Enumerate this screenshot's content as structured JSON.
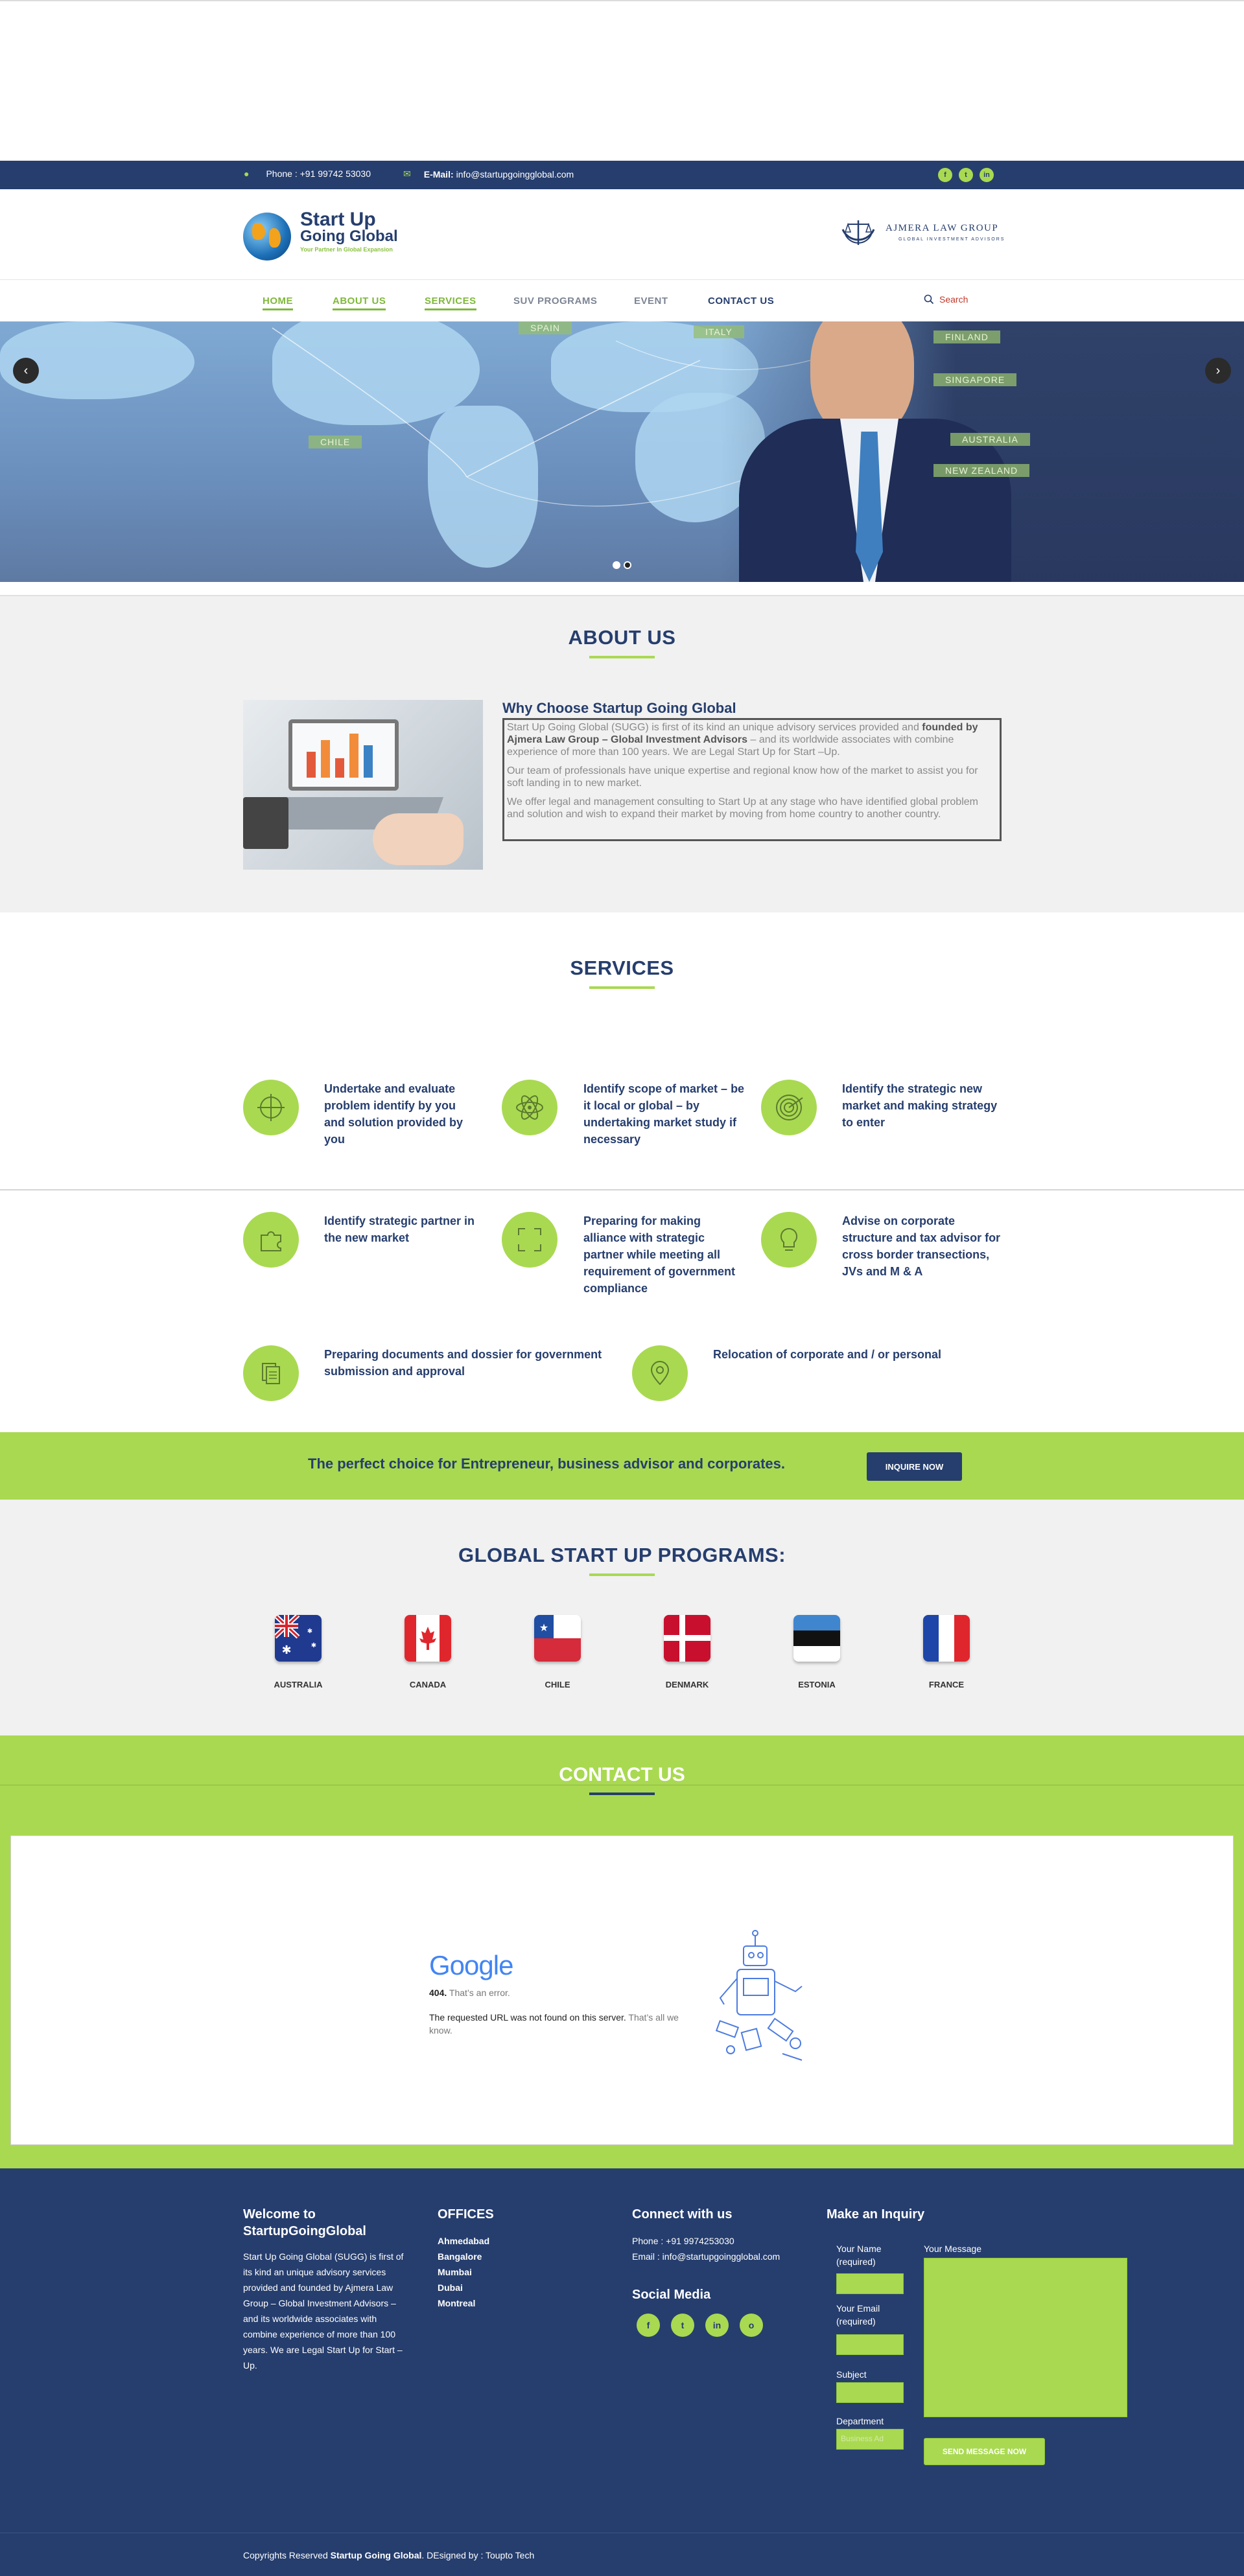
{
  "topbar": {
    "phone": "Phone : +91 99742 53030",
    "email_label": "E-Mail:",
    "email": "info@startupgoingglobal.com",
    "social": [
      "f",
      "t",
      "in"
    ]
  },
  "header": {
    "logo_line1": "Start Up",
    "logo_line2": "Going Global",
    "logo_tagline": "Your Partner In Global Expansion",
    "partner_name": "AJMERA LAW GROUP",
    "partner_tagline": "GLOBAL INVESTMENT ADVISORS"
  },
  "nav": {
    "items": [
      "HOME",
      "ABOUT US",
      "SERVICES",
      "SUV PROGRAMS",
      "EVENT",
      "CONTACT US"
    ],
    "search": "Search"
  },
  "hero": {
    "tags": [
      "SPAIN",
      "ITALY",
      "FINLAND",
      "SINGAPORE",
      "CHILE",
      "AUSTRALIA",
      "NEW ZEALAND"
    ]
  },
  "about": {
    "title": "ABOUT US",
    "heading": "Why Choose Startup Going Global",
    "p1_a": "Start Up Going Global (SUGG) is first of its kind an unique advisory services provided and ",
    "p1_b": "founded by Ajmera Law Group – Global Investment Advisors",
    "p1_c": " – and its worldwide associates with combine experience of more than 100 years. We are Legal Start Up for Start –Up.",
    "p2": "Our team of professionals have unique expertise and regional know how of the market to assist you for soft landing in to new market.",
    "p3": "We offer legal and management consulting to Start Up at any stage who have identified global problem and solution and wish to expand their market by moving from home country to another country."
  },
  "services": {
    "title": "SERVICES",
    "items": [
      "Undertake and evaluate problem identify by you and solution provided by you",
      "Identify scope of market – be it local or global – by undertaking market study if necessary",
      "Identify the strategic new market and making strategy to enter",
      "Identify strategic partner in the new market",
      "Preparing for making alliance with strategic partner while meeting all requirement of government compliance",
      "Advise on corporate structure and tax advisor for cross border transections, JVs and M & A",
      "Preparing documents and dossier for government submission and approval",
      "Relocation of corporate and / or personal"
    ]
  },
  "band": {
    "text": "The perfect choice for Entrepreneur, business advisor and corporates.",
    "button": "INQUIRE NOW"
  },
  "programs": {
    "title": "GLOBAL START UP PROGRAMS:",
    "countries": [
      "AUSTRALIA",
      "CANADA",
      "CHILE",
      "DENMARK",
      "ESTONIA",
      "FRANCE"
    ]
  },
  "contact": {
    "title": "CONTACT US",
    "map_brand": "Google",
    "map_code": "404.",
    "map_error": "That’s an error.",
    "map_msg_a": "The requested URL was not found on this server.",
    "map_msg_b": "That’s all we know."
  },
  "footer": {
    "welcome_title": "Welcome to StartupGoingGlobal",
    "welcome_text": "Start Up Going Global (SUGG) is first of its kind an unique advisory services provided and founded by Ajmera Law Group – Global Investment Advisors – and its worldwide associates with combine experience of more than 100 years. We are Legal Start Up for Start – Up.",
    "offices_title": "OFFICES",
    "offices": [
      "Ahmedabad",
      "Bangalore",
      "Mumbai",
      "Dubai",
      "Montreal"
    ],
    "connect_title": "Connect with us",
    "phone": "Phone : +91 9974253030",
    "email": "Email : info@startupgoingglobal.com",
    "social_title": "Social Media",
    "social": [
      "f",
      "t",
      "in",
      "o"
    ],
    "inquiry_title": "Make an Inquiry",
    "name_label": "Your Name (required)",
    "email_label": "Your Email (required)",
    "subject_label": "Subject",
    "department_label": "Department",
    "department_placeholder": "Business Ad",
    "message_label": "Your Message",
    "send_button": "SEND MESSAGE NOW"
  },
  "copyright": {
    "prefix": "Copyrights Reserved ",
    "brand": "Startup Going Global",
    "suffix": ". DEsigned by : Toupto Tech"
  },
  "colors": {
    "navy": "#263e6e",
    "green": "#a9d951",
    "nav_active": "#7fb83a",
    "search_red": "#c0392b"
  }
}
